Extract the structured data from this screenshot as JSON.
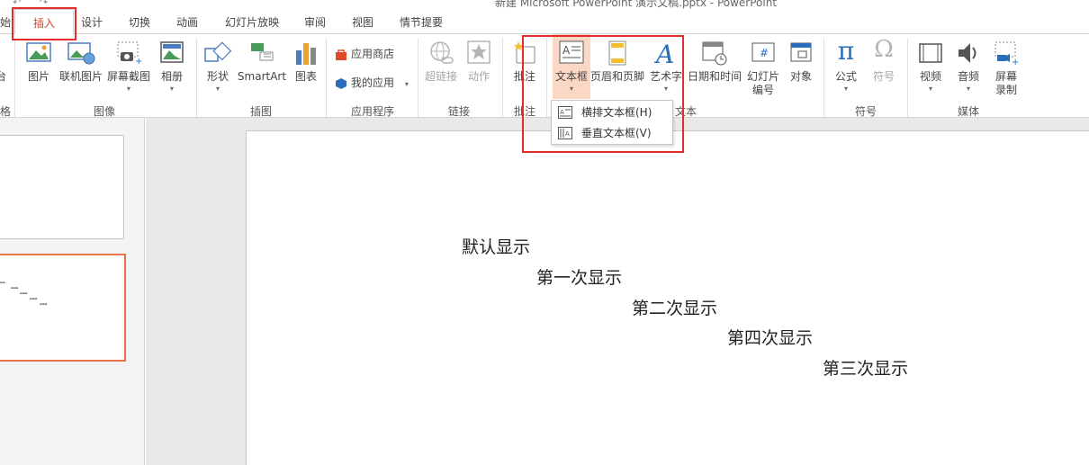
{
  "titlebar": {
    "title": "新建 Microsoft PowerPoint 演示文稿.pptx - PowerPoint"
  },
  "tabs": [
    {
      "id": "start",
      "label": "始"
    },
    {
      "id": "insert",
      "label": "插入",
      "active": true
    },
    {
      "id": "design",
      "label": "设计"
    },
    {
      "id": "transitions",
      "label": "切换"
    },
    {
      "id": "animations",
      "label": "动画"
    },
    {
      "id": "slideshow",
      "label": "幻灯片放映"
    },
    {
      "id": "review",
      "label": "审阅"
    },
    {
      "id": "view",
      "label": "视图"
    },
    {
      "id": "storyboard",
      "label": "情节提要"
    }
  ],
  "ribbon": {
    "partial_left": {
      "label": "台",
      "group_label": "格"
    },
    "images": {
      "group_label": "图像",
      "picture": "图片",
      "online_picture": "联机图片",
      "screenshot": "屏幕截图",
      "album": "相册"
    },
    "illustrations": {
      "group_label": "插图",
      "shapes": "形状",
      "smartart": "SmartArt",
      "chart": "图表"
    },
    "apps": {
      "group_label": "应用程序",
      "store": "应用商店",
      "my_apps": "我的应用"
    },
    "links": {
      "group_label": "链接",
      "hyperlink": "超链接",
      "action": "动作"
    },
    "comments": {
      "group_label": "批注",
      "comment": "批注"
    },
    "text": {
      "group_label": "文本",
      "textbox": "文本框",
      "header_footer": "页眉和页脚",
      "wordart": "艺术字",
      "datetime": "日期和时间",
      "slide_number_1": "幻灯片",
      "slide_number_2": "编号",
      "object": "对象"
    },
    "symbols": {
      "group_label": "符号",
      "equation": "公式",
      "symbol": "符号"
    },
    "media": {
      "group_label": "媒体",
      "video": "视频",
      "audio": "音频",
      "recording_1": "屏幕",
      "recording_2": "录制"
    }
  },
  "dropdown": {
    "items": [
      {
        "label": "横排文本框(H)"
      },
      {
        "label": "垂直文本框(V)"
      }
    ]
  },
  "slide": {
    "lines": [
      "默认显示",
      "第一次显示",
      "第二次显示",
      "第四次显示",
      "第三次显示"
    ]
  },
  "colors": {
    "accent": "#d24726",
    "annotation": "#e52c2c",
    "selected_thumb": "#e8704a",
    "highlight": "#fbd8c6"
  }
}
